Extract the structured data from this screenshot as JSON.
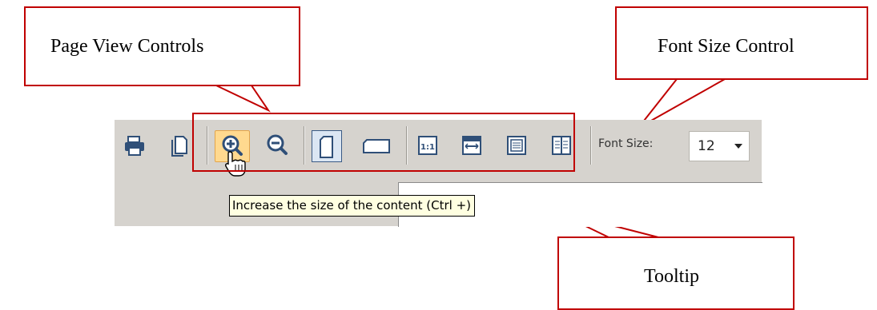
{
  "toolbar": {
    "buttons": [
      {
        "id": "print",
        "icon": "printer-icon"
      },
      {
        "id": "page",
        "icon": "document-icon"
      },
      {
        "id": "zoom-in",
        "icon": "zoom-in-icon",
        "state": "hover"
      },
      {
        "id": "zoom-out",
        "icon": "zoom-out-icon"
      },
      {
        "id": "portrait",
        "icon": "portrait-page-icon",
        "state": "selected"
      },
      {
        "id": "landscape",
        "icon": "landscape-page-icon"
      },
      {
        "id": "actual-size",
        "icon": "actual-size-icon"
      },
      {
        "id": "fit-width",
        "icon": "fit-width-icon"
      },
      {
        "id": "single-page",
        "icon": "single-page-icon"
      },
      {
        "id": "two-page",
        "icon": "two-page-icon"
      }
    ],
    "actual_size_glyph": "1:1",
    "font_size_label": "Font Size:",
    "font_size_value": "12"
  },
  "tooltip": {
    "text": "Increase the size of the content (Ctrl +)"
  },
  "callouts": {
    "page_view_controls": "Page View Controls",
    "font_size_control": "Font Size Control",
    "tooltip": "Tooltip"
  },
  "colors": {
    "callout_border": "#c00000",
    "toolbar_bg": "#d6d3ce",
    "icon_blue": "#2f4f78",
    "hover_bg": "#ffd98f",
    "tooltip_bg": "#ffffe1"
  }
}
